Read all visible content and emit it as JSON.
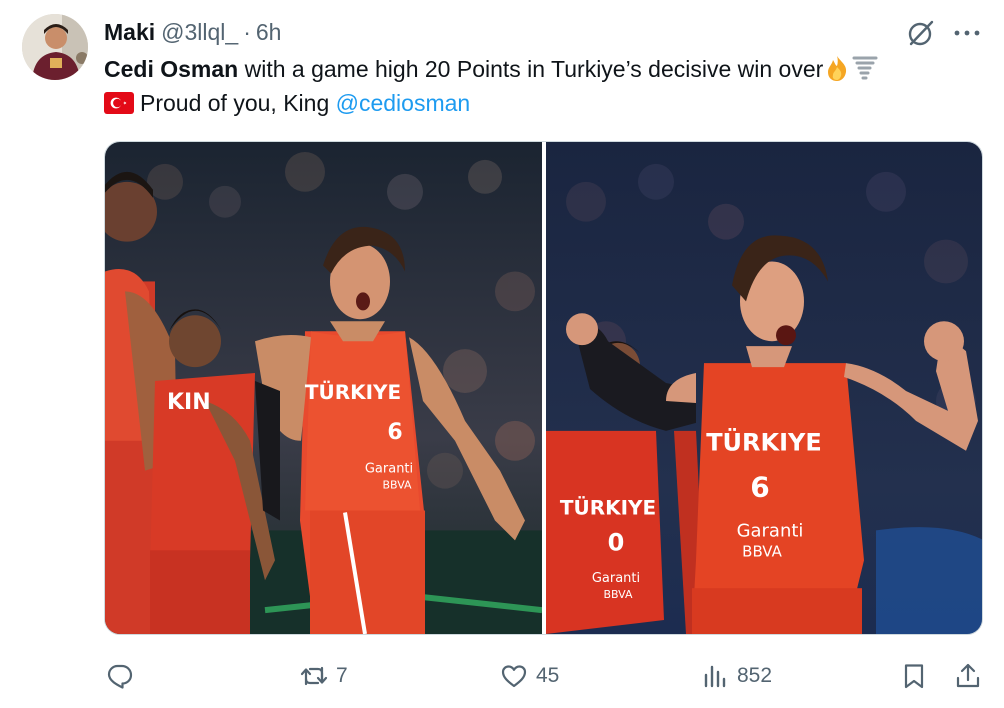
{
  "tweet": {
    "display_name": "Maki",
    "handle": "@3llql_",
    "separator": "·",
    "time": "6h",
    "text_bold": "Cedi Osman",
    "text_line1": " with a game high 20 Points in Turkiye’s decisive win over",
    "text_line2": "Proud of you, King ",
    "mention": "@cediosman",
    "jersey_text": "TÜRKIYE",
    "jersey_number_main": "6",
    "jersey_number_other": "0",
    "sponsor_line1": "Garanti",
    "sponsor_line2": "BBVA",
    "partial_jersey_text": "KIN"
  },
  "actions": {
    "reply_count": "",
    "repost_count": "7",
    "like_count": "45",
    "view_count": "852"
  },
  "colors": {
    "link": "#1d9bf0",
    "muted": "#536471",
    "text": "#0f1419",
    "jersey_red": "#e13a2a"
  },
  "icons": [
    "grok-icon",
    "more-icon",
    "turkey-flag-icon",
    "fire-emoji-icon",
    "tornado-emoji-icon",
    "reply-icon",
    "repost-icon",
    "like-icon",
    "views-icon",
    "bookmark-icon",
    "share-icon"
  ]
}
